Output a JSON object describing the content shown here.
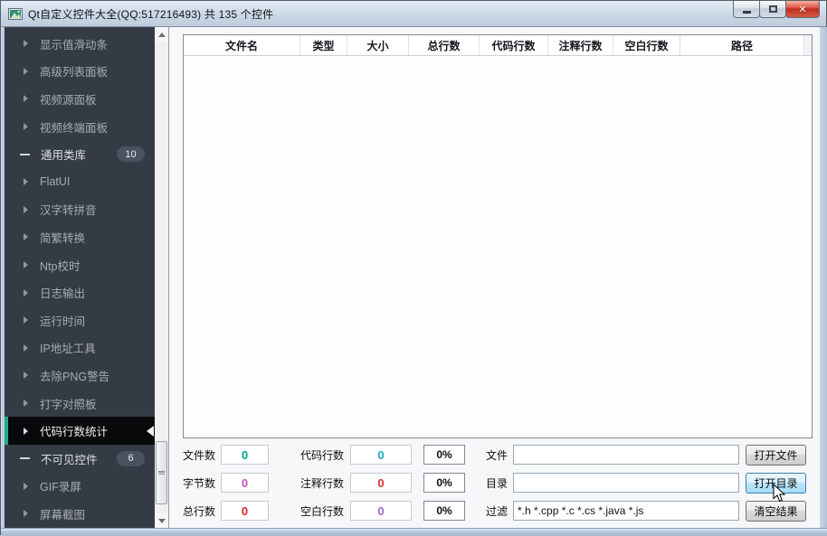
{
  "titlebar": {
    "title": "Qt自定义控件大全(QQ:517216493) 共 135 个控件"
  },
  "sidebar": {
    "selected": "代码行数统计",
    "items": [
      {
        "label": "显示值滑动条"
      },
      {
        "label": "高级列表面板"
      },
      {
        "label": "视频源面板"
      },
      {
        "label": "视频终端面板"
      },
      {
        "label": "通用类库",
        "badge": "10"
      },
      {
        "label": "FlatUI"
      },
      {
        "label": "汉字转拼音"
      },
      {
        "label": "简繁转换"
      },
      {
        "label": "Ntp校时"
      },
      {
        "label": "日志输出"
      },
      {
        "label": "运行时间"
      },
      {
        "label": "IP地址工具"
      },
      {
        "label": "去除PNG警告"
      },
      {
        "label": "打字对照板"
      },
      {
        "label": "代码行数统计"
      },
      {
        "label": "不可见控件",
        "badge": "6"
      },
      {
        "label": "GIF录屏"
      },
      {
        "label": "屏幕截图"
      }
    ]
  },
  "table": {
    "columns": [
      {
        "label": "文件名"
      },
      {
        "label": "类型"
      },
      {
        "label": "大小"
      },
      {
        "label": "总行数"
      },
      {
        "label": "代码行数"
      },
      {
        "label": "注释行数"
      },
      {
        "label": "空白行数"
      },
      {
        "label": "路径"
      }
    ]
  },
  "stats": {
    "rows": [
      {
        "label1": "文件数",
        "value1": "0",
        "color1": "#00a48c",
        "label2": "代码行数",
        "value2": "0",
        "color2": "#1ca9b8",
        "percent": "0%",
        "field_label": "文件",
        "field_value": "",
        "button": "打开文件"
      },
      {
        "label1": "字节数",
        "value1": "0",
        "color1": "#c750bc",
        "label2": "注释行数",
        "value2": "0",
        "color2": "#d8322d",
        "percent": "0%",
        "field_label": "目录",
        "field_value": "",
        "button": "打开目录"
      },
      {
        "label1": "总行数",
        "value1": "0",
        "color1": "#d8262b",
        "label2": "空白行数",
        "value2": "0",
        "color2": "#9b6bc3",
        "percent": "0%",
        "field_label": "过滤",
        "field_value": "*.h *.cpp *.c *.cs *.java *.js",
        "button": "清空结果"
      }
    ]
  },
  "colors": {
    "sidebar_bg": "#353b45",
    "selected_bg": "#07090b",
    "accent_teal": "#1fa98e",
    "badge_bg": "#4a5160",
    "close_red": "#c02e1d"
  }
}
